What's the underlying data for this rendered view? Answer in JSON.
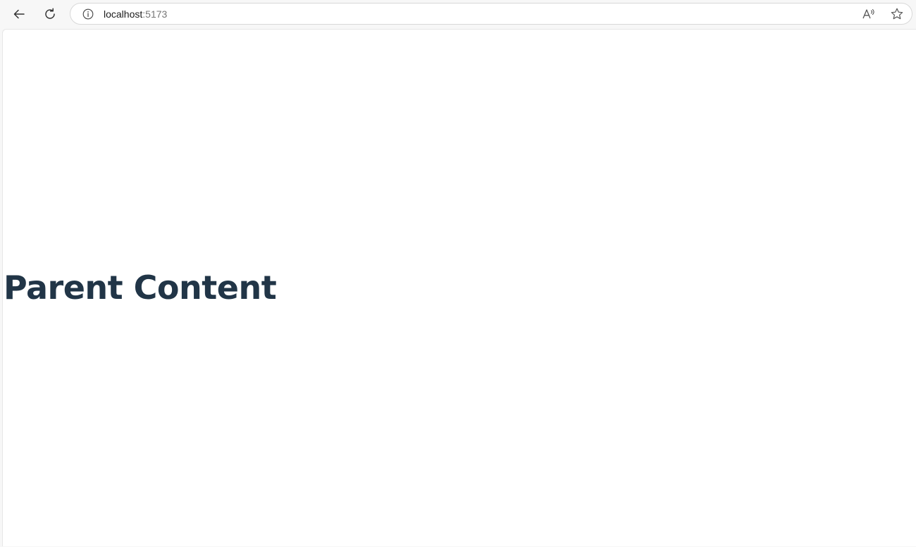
{
  "browser": {
    "url_host": "localhost",
    "url_port": ":5173",
    "icons": {
      "back": "back-arrow-icon",
      "reload": "reload-icon",
      "site_info": "info-icon",
      "read_aloud": "read-aloud-icon",
      "favorite": "star-icon"
    }
  },
  "page": {
    "heading": "Parent Content"
  },
  "colors": {
    "heading": "#213547",
    "toolbar_bg": "#f7f7f7",
    "page_bg": "#ffffff"
  }
}
